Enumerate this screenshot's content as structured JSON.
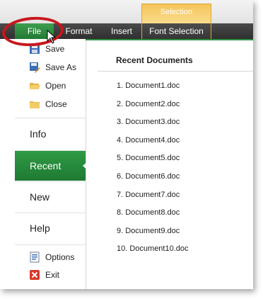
{
  "ribbon": {
    "tabs": [
      "File",
      "Format",
      "Insert",
      "Font Selection"
    ],
    "context_group": "Selection"
  },
  "backstage": {
    "commands": [
      "Save",
      "Save As",
      "Open",
      "Close"
    ],
    "items": [
      "Info",
      "Recent",
      "New",
      "Help"
    ],
    "selected_item": "Recent",
    "footer_commands": [
      "Options",
      "Exit"
    ]
  },
  "recent": {
    "title": "Recent Documents",
    "documents": [
      "1. Document1.doc",
      "2. Document2.doc",
      "3. Document3.doc",
      "4. Document4.doc",
      "5. Document5.doc",
      "6. Document6.doc",
      "7. Document7.doc",
      "8. Document8.doc",
      "9. Document9.doc",
      "10. Document10.doc"
    ]
  },
  "colors": {
    "accent_green": "#227a34",
    "context_orange": "#f6c45a",
    "annotation_red": "#c8161d"
  },
  "icons": {
    "save": "floppy-disk-icon",
    "save_as": "save-as-icon",
    "open": "folder-open-icon",
    "close": "folder-close-icon",
    "options": "options-icon",
    "exit": "exit-icon"
  }
}
